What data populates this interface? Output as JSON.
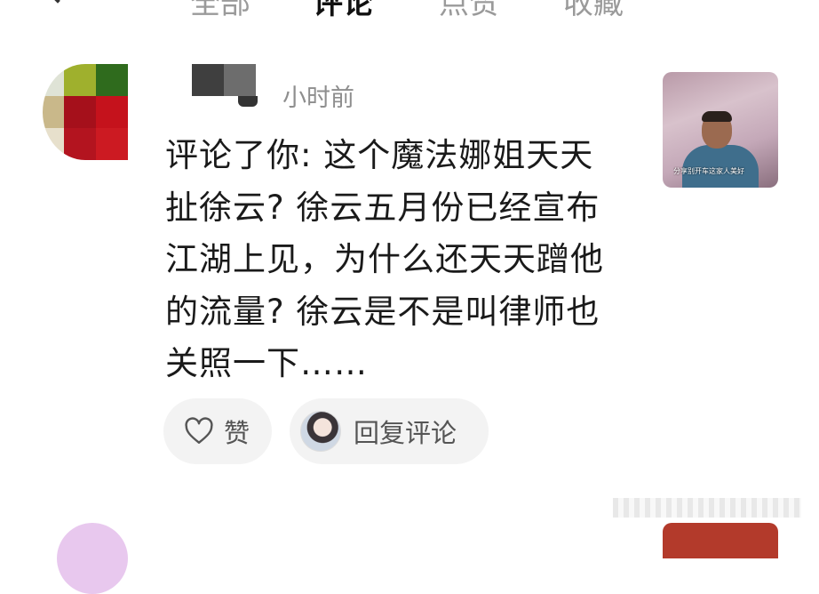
{
  "tabs": [
    {
      "label": "全部"
    },
    {
      "label": "评论"
    },
    {
      "label": "点赞"
    },
    {
      "label": "收藏"
    }
  ],
  "notification": {
    "time": "小时前",
    "comment": "评论了你: 这个魔法娜姐天天扯徐云? 徐云五月份已经宣布江湖上见，为什么还天天蹭他的流量? 徐云是不是叫律师也关照一下……",
    "like_label": "赞",
    "reply_label": "回复评论",
    "thumbnail_caption": "分享别开车这家人美好"
  },
  "colors": {
    "background": "#ffffff",
    "button_bg": "#f3f3f3",
    "secondary_text": "#8e8e8e"
  }
}
